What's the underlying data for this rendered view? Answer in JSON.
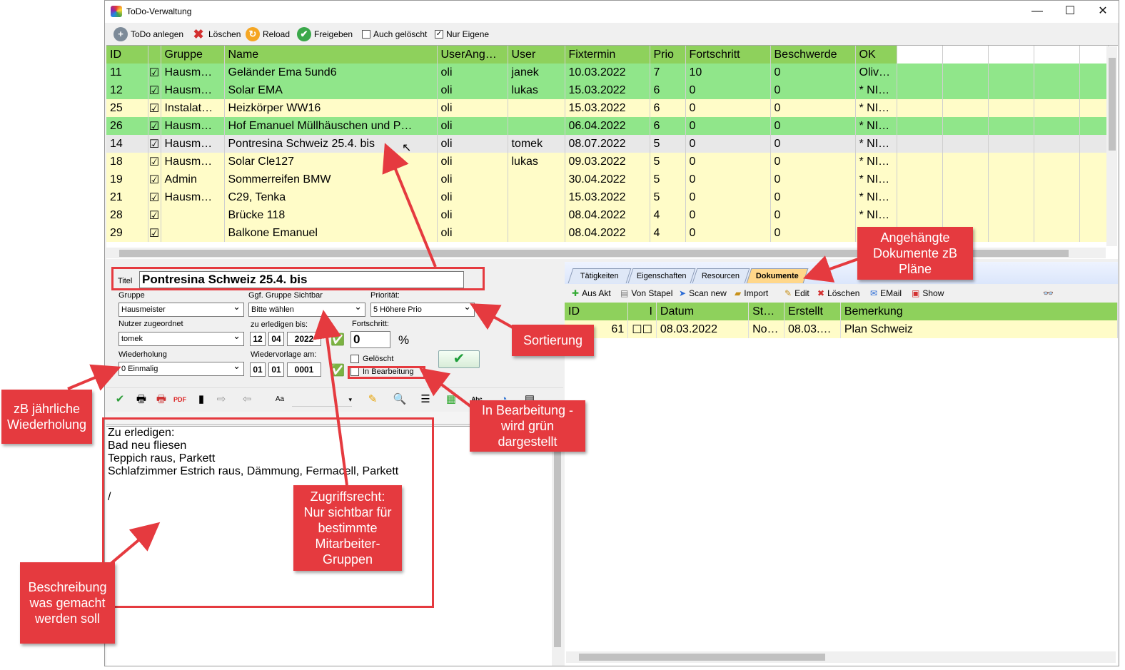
{
  "window": {
    "title": "ToDo-Verwaltung",
    "minimize": "—",
    "maximize": "☐",
    "close": "✕"
  },
  "toolbar": {
    "todo_anlegen": "ToDo anlegen",
    "loeschen": "Löschen",
    "reload": "Reload",
    "freigeben": "Freigeben",
    "auch_geloescht": "Auch gelöscht",
    "nur_eigene": "Nur Eigene"
  },
  "grid": {
    "columns": [
      "ID",
      "",
      "Gruppe",
      "Name",
      "UserAng…",
      "User",
      "Fixtermin",
      "Prio",
      "Fortschritt",
      "Beschwerde",
      "OK"
    ],
    "rows": [
      {
        "id": "11",
        "chk": "☑",
        "gruppe": "Hausm…",
        "name": "Geländer Ema 5und6",
        "userang": "oli",
        "user": "janek",
        "fix": "10.03.2022",
        "prio": "7",
        "fort": "10",
        "besch": "0",
        "ok": "Oliv…",
        "style": "g"
      },
      {
        "id": "12",
        "chk": "☑",
        "gruppe": "Hausm…",
        "name": "Solar EMA",
        "userang": "oli",
        "user": "lukas",
        "fix": "15.03.2022",
        "prio": "6",
        "fort": "0",
        "besch": "0",
        "ok": "* NI…",
        "style": "g"
      },
      {
        "id": "25",
        "chk": "☑",
        "gruppe": "Instalat…",
        "name": "Heizkörper WW16",
        "userang": "oli",
        "user": "",
        "fix": "15.03.2022",
        "prio": "6",
        "fort": "0",
        "besch": "0",
        "ok": "* NI…",
        "style": "y"
      },
      {
        "id": "26",
        "chk": "☑",
        "gruppe": "Hausm…",
        "name": "Hof Emanuel Müllhäuschen und P…",
        "userang": "oli",
        "user": "",
        "fix": "06.04.2022",
        "prio": "6",
        "fort": "0",
        "besch": "0",
        "ok": "* NI…",
        "style": "g"
      },
      {
        "id": "14",
        "chk": "☑",
        "gruppe": "Hausm…",
        "name": "Pontresina Schweiz 25.4. bis",
        "userang": "oli",
        "user": "tomek",
        "fix": "08.07.2022",
        "prio": "5",
        "fort": "0",
        "besch": "0",
        "ok": "* NI…",
        "style": "s"
      },
      {
        "id": "18",
        "chk": "☑",
        "gruppe": "Hausm…",
        "name": "Solar Cle127",
        "userang": "oli",
        "user": "lukas",
        "fix": "09.03.2022",
        "prio": "5",
        "fort": "0",
        "besch": "0",
        "ok": "* NI…",
        "style": "y"
      },
      {
        "id": "19",
        "chk": "☑",
        "gruppe": "Admin",
        "name": "Sommerreifen BMW",
        "userang": "oli",
        "user": "",
        "fix": "30.04.2022",
        "prio": "5",
        "fort": "0",
        "besch": "0",
        "ok": "* NI…",
        "style": "y"
      },
      {
        "id": "21",
        "chk": "☑",
        "gruppe": "Hausm…",
        "name": "C29, Tenka",
        "userang": "oli",
        "user": "",
        "fix": "15.03.2022",
        "prio": "5",
        "fort": "0",
        "besch": "0",
        "ok": "* NI…",
        "style": "y"
      },
      {
        "id": "28",
        "chk": "☑",
        "gruppe": "",
        "name": "Brücke 118",
        "userang": "oli",
        "user": "",
        "fix": "08.04.2022",
        "prio": "4",
        "fort": "0",
        "besch": "0",
        "ok": "* NI…",
        "style": "y"
      },
      {
        "id": "29",
        "chk": "☑",
        "gruppe": "",
        "name": "Balkone Emanuel",
        "userang": "oli",
        "user": "",
        "fix": "08.04.2022",
        "prio": "4",
        "fort": "0",
        "besch": "0",
        "ok": "* NI…",
        "style": "y"
      }
    ]
  },
  "form": {
    "titel_label": "Titel",
    "titel_value": "Pontresina Schweiz 25.4. bis",
    "gruppe_label": "Gruppe",
    "gruppe_value": "Hausmeister",
    "sichtbar_label": "Ggf. Gruppe Sichtbar",
    "sichtbar_value": "Bitte wählen",
    "prioritaet_label": "Priorität:",
    "prioritaet_value": "5 Höhere Prio",
    "nutzer_label": "Nutzer zugeordnet",
    "nutzer_value": "tomek",
    "erledigen_label": "zu erledigen bis:",
    "erledigen_day": "12",
    "erledigen_month": "04",
    "erledigen_year": "2022",
    "fortschritt_label": "Fortschritt:",
    "fortschritt_value": "0",
    "percent": "%",
    "wiederholung_label": "Wiederholung",
    "wiederholung_value": "0 Einmalig",
    "wiedervorlage_label": "Wiedervorlage am:",
    "wv_day": "01",
    "wv_month": "01",
    "wv_year": "0001",
    "geloescht": "Gelöscht",
    "in_bearbeitung": "In Bearbeitung"
  },
  "editor": {
    "lines": [
      "Zu erledigen:",
      "Bad neu fliesen",
      "Teppich raus, Parkett",
      "Schlafzimmer Estrich raus, Dämmung, Fermacell, Parkett",
      "",
      "/"
    ]
  },
  "tabs": [
    "Tätigkeiten",
    "Eigenschaften",
    "Resourcen",
    "Dokumente"
  ],
  "doc_toolbar": {
    "aus_akt": "Aus Akt",
    "von_stapel": "Von Stapel",
    "scan_new": "Scan new",
    "import": "Import",
    "edit": "Edit",
    "loeschen": "Löschen",
    "email": "EMail",
    "show": "Show"
  },
  "doc_grid": {
    "columns": [
      "ID",
      "I",
      "Datum",
      "St…",
      "Erstellt",
      "Bemerkung"
    ],
    "rows": [
      {
        "id": "61",
        "i": "☐☐",
        "datum": "08.03.2022",
        "st": "No…",
        "erstellt": "08.03.…",
        "bemerkung": "Plan Schweiz"
      }
    ]
  },
  "callouts": {
    "dokumente": "Angehängte\nDokumente zB\nPläne",
    "sortierung": "Sortierung",
    "bearbeitung": "In Bearbeitung -\nwird grün\ndargestellt",
    "wiederholung": "zB jährliche\nWiederholung",
    "zugriff": "Zugriffsrecht:\nNur sichtbar für\nbestimmte\nMitarbeiter-\nGruppen",
    "beschreibung": "Beschreibung\nwas gemacht\nwerden soll"
  },
  "colors": {
    "row_green": "#90e68a",
    "row_yellow": "#fffcc8",
    "header_green": "#8ed15c",
    "callout_red": "#e53a3f"
  }
}
